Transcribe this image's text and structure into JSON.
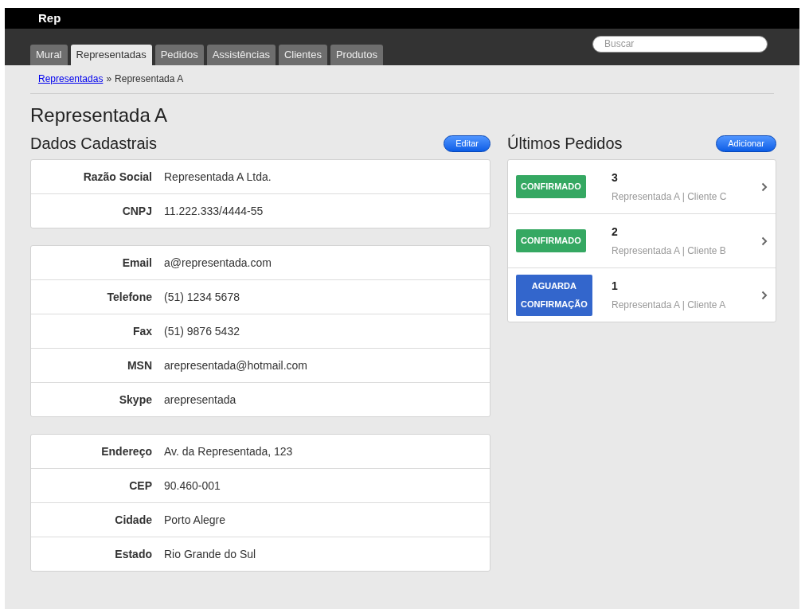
{
  "brand": "Rep",
  "tabs": [
    {
      "label": "Mural",
      "selected": false
    },
    {
      "label": "Representadas",
      "selected": true
    },
    {
      "label": "Pedidos",
      "selected": false
    },
    {
      "label": "Assistências",
      "selected": false
    },
    {
      "label": "Clientes",
      "selected": false
    },
    {
      "label": "Produtos",
      "selected": false
    }
  ],
  "search": {
    "placeholder": "Buscar"
  },
  "breadcrumb": {
    "link": "Representadas",
    "separator": "»",
    "current": "Representada A"
  },
  "title": "Representada A",
  "details": {
    "heading": "Dados Cadastrais",
    "button": "Editar",
    "groups": [
      [
        {
          "label": "Razão Social",
          "value": "Representada A Ltda."
        },
        {
          "label": "CNPJ",
          "value": "11.222.333/4444-55"
        }
      ],
      [
        {
          "label": "Email",
          "value": "a@representada.com"
        },
        {
          "label": "Telefone",
          "value": "(51) 1234 5678"
        },
        {
          "label": "Fax",
          "value": "(51) 9876 5432"
        },
        {
          "label": "MSN",
          "value": "arepresentada@hotmail.com"
        },
        {
          "label": "Skype",
          "value": "arepresentada"
        }
      ],
      [
        {
          "label": "Endereço",
          "value": "Av. da Representada, 123"
        },
        {
          "label": "CEP",
          "value": "90.460-001"
        },
        {
          "label": "Cidade",
          "value": "Porto Alegre"
        },
        {
          "label": "Estado",
          "value": "Rio Grande do Sul"
        }
      ]
    ]
  },
  "orders": {
    "heading": "Últimos Pedidos",
    "button": "Adicionar",
    "items": [
      {
        "status": [
          "CONFIRMADO"
        ],
        "color": "#35a862",
        "number": "3",
        "subtitle": "Representada A | Cliente C"
      },
      {
        "status": [
          "CONFIRMADO"
        ],
        "color": "#35a862",
        "number": "2",
        "subtitle": "Representada A | Cliente B"
      },
      {
        "status": [
          "AGUARDA",
          "CONFIRMAÇÃO"
        ],
        "color": "#3366cc",
        "number": "1",
        "subtitle": "Representada A | Cliente A"
      }
    ]
  }
}
